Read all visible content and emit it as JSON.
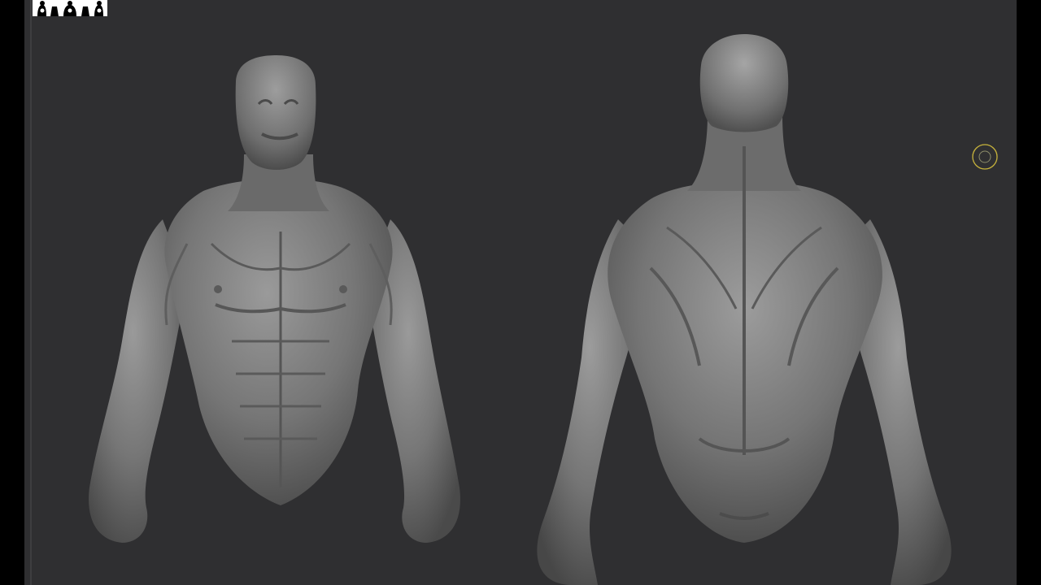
{
  "viewport": {
    "background": "#2f2f31",
    "frame_color": "#000000"
  },
  "logo": {
    "icon": "figure-silhouette-logo",
    "background": "#ffffff"
  },
  "models": {
    "front": {
      "icon": "torso-front-sculpt",
      "material": "#7a7a7a"
    },
    "back": {
      "icon": "torso-back-sculpt",
      "material": "#7a7a7a"
    }
  },
  "cursor": {
    "icon": "brush-cursor-icon",
    "color": "#c8b43c"
  }
}
